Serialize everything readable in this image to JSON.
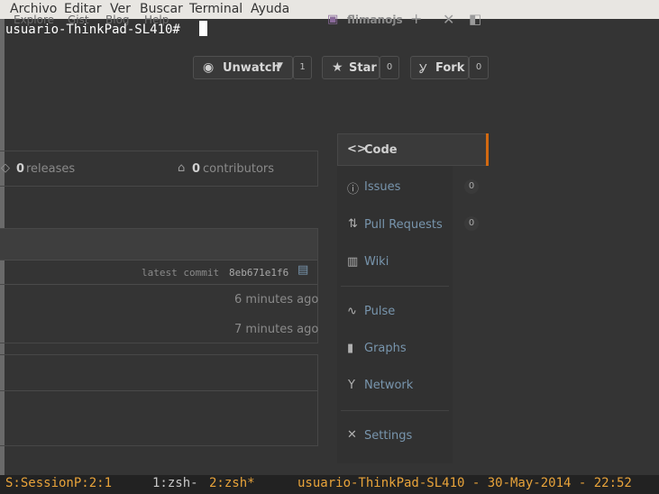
{
  "menu": {
    "items": [
      "Archivo",
      "Editar",
      "Ver",
      "Buscar",
      "Terminal",
      "Ayuda"
    ]
  },
  "terminal": {
    "prompt": "usuario-ThinkPad-SL410#"
  },
  "background": {
    "top_nav": [
      "Explore",
      "Gist",
      "Blog",
      "Help"
    ],
    "username": "flimanojs",
    "watch": {
      "label": "Unwatch",
      "count": "1"
    },
    "star": {
      "label": "Star",
      "count": "0"
    },
    "fork": {
      "label": "Fork",
      "count": "0"
    },
    "releases": {
      "count": "0",
      "label": "releases"
    },
    "contributors": {
      "count": "0",
      "label": "contributors"
    },
    "latest_commit": {
      "label": "latest commit",
      "hash": "8eb671e1f6"
    },
    "times": [
      "6 minutes ago",
      "7 minutes ago"
    ],
    "sidebar": {
      "code": "Code",
      "issues": {
        "label": "Issues",
        "count": "0"
      },
      "pulls": {
        "label": "Pull Requests",
        "count": "0"
      },
      "wiki": "Wiki",
      "pulse": "Pulse",
      "graphs": "Graphs",
      "network": "Network",
      "settings": "Settings"
    }
  },
  "status": {
    "session": "S:SessionP:2:1",
    "win1": "1:zsh-",
    "win2": "2:zsh*",
    "info": "usuario-ThinkPad-SL410 - 30-May-2014 - 22:52"
  },
  "colors": {
    "status_accent": "#e8a33a",
    "terminal_bg": "#343434",
    "menubar_bg": "#e8e6e2",
    "code_tab_accent": "#d26911"
  }
}
